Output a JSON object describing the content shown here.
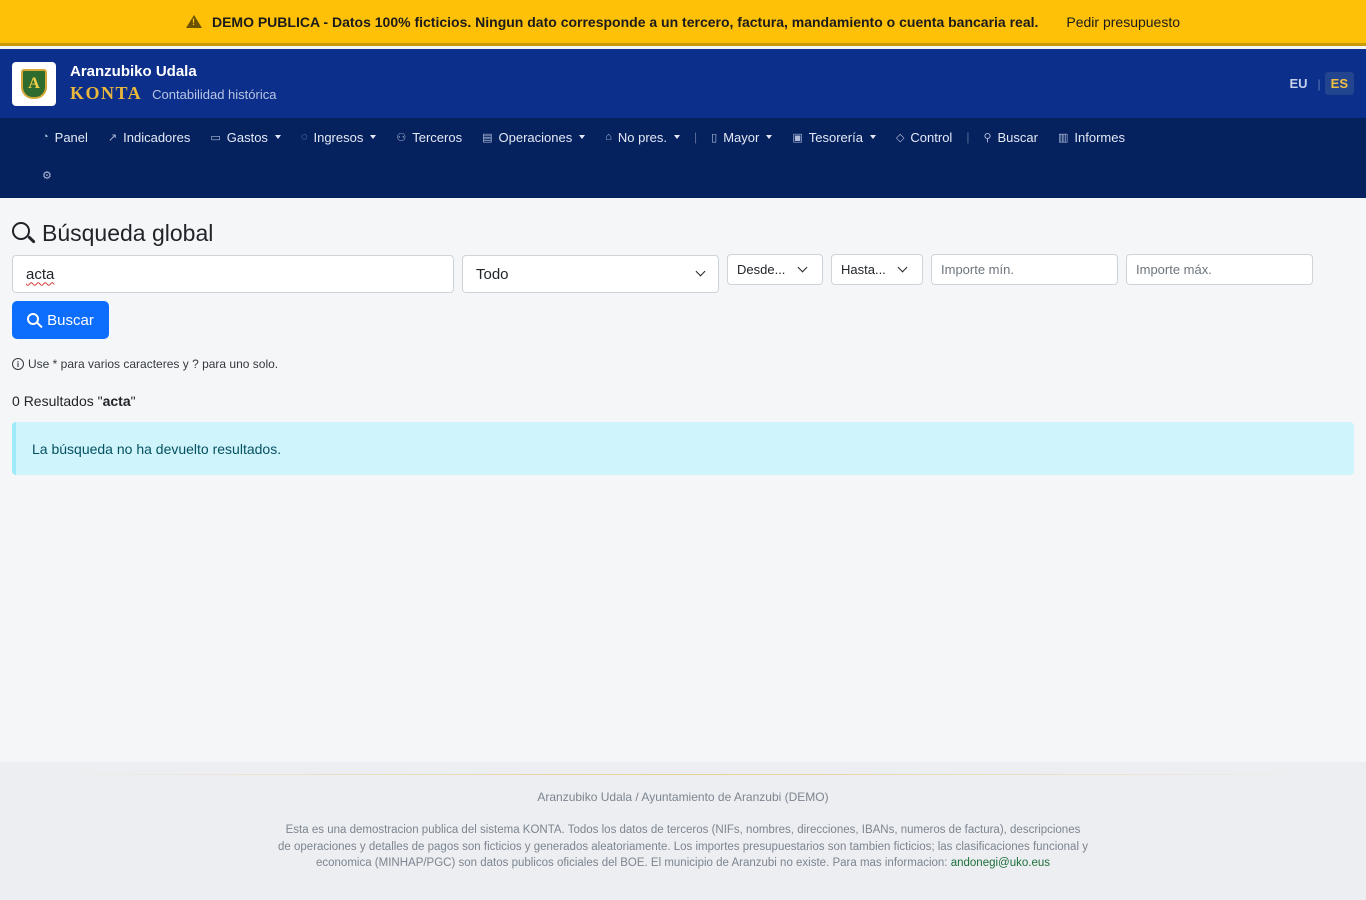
{
  "banner": {
    "message": "DEMO PUBLICA - Datos 100% ficticios. Ningun dato corresponde a un tercero, factura, mandamiento o cuenta bancaria real.",
    "link": "Pedir presupuesto",
    "color": "#ffc107"
  },
  "header": {
    "org_name": "Aranzubiko Udala",
    "product": "KONTA",
    "subtitle": "Contabilidad histórica",
    "logo_letter": "A",
    "lang_eu": "EU",
    "lang_sep": "|",
    "lang_es": "ES",
    "bg_color": "#0b2f8a"
  },
  "nav": {
    "items": [
      {
        "label": "Panel",
        "icon": "dashboard-icon",
        "glyph": "◔"
      },
      {
        "label": "Indicadores",
        "icon": "chart-line-icon",
        "glyph": "↗"
      },
      {
        "label": "Gastos",
        "icon": "wallet-icon",
        "glyph": "▭"
      },
      {
        "label": "Ingresos",
        "icon": "piggy-bank-icon",
        "glyph": "◌"
      },
      {
        "label": "Terceros",
        "icon": "people-icon",
        "glyph": "⚇"
      },
      {
        "label": "Operaciones",
        "icon": "list-icon",
        "glyph": "▤"
      },
      {
        "label": "No pres.",
        "icon": "bank-icon",
        "glyph": "⌂"
      },
      {
        "label": "Mayor",
        "icon": "journal-icon",
        "glyph": "▯"
      },
      {
        "label": "Tesorería",
        "icon": "safe-icon",
        "glyph": "▣"
      },
      {
        "label": "Control",
        "icon": "shield-check-icon",
        "glyph": "◇"
      },
      {
        "label": "Buscar",
        "icon": "search-icon",
        "glyph": "⚲"
      },
      {
        "label": "Informes",
        "icon": "report-icon",
        "glyph": "▥"
      }
    ],
    "separator": "|",
    "settings_glyph": "⚙",
    "bg_color": "#05215e"
  },
  "page": {
    "title": "Búsqueda global"
  },
  "search": {
    "query": "acta",
    "scope": "Todo",
    "from": "Desde...",
    "to": "Hasta...",
    "min_amount_placeholder": "Importe mín.",
    "max_amount_placeholder": "Importe máx.",
    "button": "Buscar",
    "hint": "Use * para varios caracteres y ? para uno solo.",
    "info_glyph": "i"
  },
  "results": {
    "count": "0",
    "label": "Resultados",
    "query_display": "acta",
    "empty_message": "La búsqueda no ha devuelto resultados."
  },
  "footer": {
    "org": "Aranzubiko Udala / Ayuntamiento de Aranzubi (DEMO)",
    "disclaimer": "Esta es una demostracion publica del sistema KONTA. Todos los datos de terceros (NIFs, nombres, direcciones, IBANs, numeros de factura), descripciones de operaciones y detalles de pagos son ficticios y generados aleatoriamente. Los importes presupuestarios son tambien ficticios; las clasificaciones funcional y economica (MINHAP/PGC) son datos publicos oficiales del BOE. El municipio de Aranzubi no existe. Para mas informacion:",
    "email": "andonegi@uko.eus"
  }
}
